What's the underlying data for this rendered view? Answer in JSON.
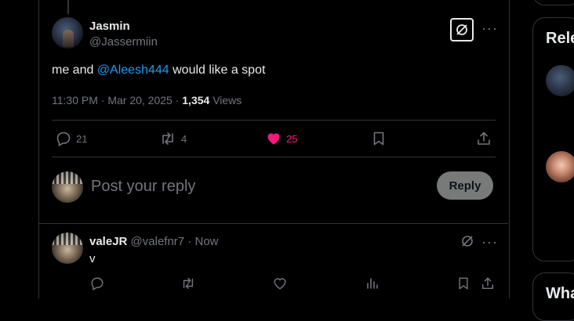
{
  "post": {
    "author_name": "Jasmin",
    "author_handle": "@Jassermiin",
    "text_before": "me and ",
    "mention": "@Aleesh444",
    "text_after": " would like a spot",
    "timestamp": "11:30 PM · Mar 20, 2025 · ",
    "views_count": "1,354",
    "views_label": "Views",
    "replies": "21",
    "reposts": "4",
    "likes": "25",
    "like_color": "#f91880"
  },
  "reply_composer": {
    "placeholder": "Post your reply",
    "button_label": "Reply"
  },
  "reply": {
    "author_name": "valeJR",
    "author_handle": "@valefnr7",
    "separator": "·",
    "time": "Now",
    "text": "v"
  },
  "sidebar": {
    "card1_title": "Rele",
    "card2_title": "Wha"
  },
  "icons": {
    "grok": "grok-icon",
    "more": "more-icon",
    "reply": "reply-icon",
    "repost": "repost-icon",
    "like": "heart-icon",
    "bookmark": "bookmark-icon",
    "share": "share-icon",
    "views": "views-icon"
  },
  "accent_color": "#1d9bf0"
}
